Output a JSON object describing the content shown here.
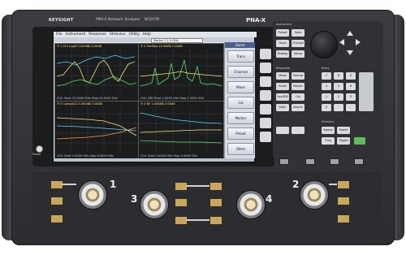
{
  "instrument": {
    "brand": "KEYSIGHT",
    "model_title": "PNA-X Network Analyzer",
    "model_number": "N5247B",
    "series_label": "PNA-X"
  },
  "screen": {
    "menu_items": [
      "File",
      "Instrument",
      "Response",
      "Stimulus",
      "Utility",
      "Help"
    ],
    "marker_button": "Marker 1  1.5 GHz",
    "panel_title": "Home",
    "softkeys": [
      "Trace",
      "Channel",
      "Meas",
      "Cal",
      "Marker",
      "Preset",
      "Other"
    ],
    "panes": [
      {
        "header": "Tr 1 S11 LogM 5.000dB/ 0.00dB",
        "footer": "Ch1: Start 10.0000 MHz        Stop 26.5000 GHz"
      },
      {
        "header": "Tr 2 PwrMax 10.00dB/ 0.00dB",
        "footer": "Ch2: IMD  Start 1.0000 GHz        Stop 2.5000 GHz"
      },
      {
        "header": "Tr 3 CompIn21 0.500dB/ 0.00dB",
        "footer": "Ch3: Start 1.0000 GHz        Stop 6.0000 GHz"
      },
      {
        "header": "Tr 4 NF 1.000dB/ 0.00dB",
        "footer": "Ch4: Start 1.0000 GHz        Stop 3.0000 GHz"
      }
    ]
  },
  "keypad": {
    "section_labels": [
      "Instrument",
      "Response",
      "Entry",
      "Stimulus"
    ],
    "instrument_keys": [
      "Preset",
      "Save",
      "Trace",
      "Channel",
      "Display",
      "Setup"
    ],
    "response_keys": [
      "Meas",
      "Format",
      "Scale",
      "Marker",
      "Avg BW",
      "Cal",
      "Math",
      "Search"
    ],
    "entry_keys": [
      "7",
      "8",
      "9",
      "4",
      "5",
      "6",
      "1",
      "2",
      "3",
      "0",
      ".",
      "-"
    ],
    "stimulus_keys": [
      "Sweep",
      "Power",
      "Freq",
      "Trigger"
    ]
  },
  "ports": {
    "labels": [
      "1",
      "2",
      "3",
      "4"
    ]
  },
  "power_label": "Power",
  "colors": {
    "trace_yellow": "#ffe27a",
    "trace_green": "#5ee06b",
    "trace_cyan": "#55d6ff",
    "trace_orange": "#ff9f40",
    "accent": "#4a5f8c"
  }
}
